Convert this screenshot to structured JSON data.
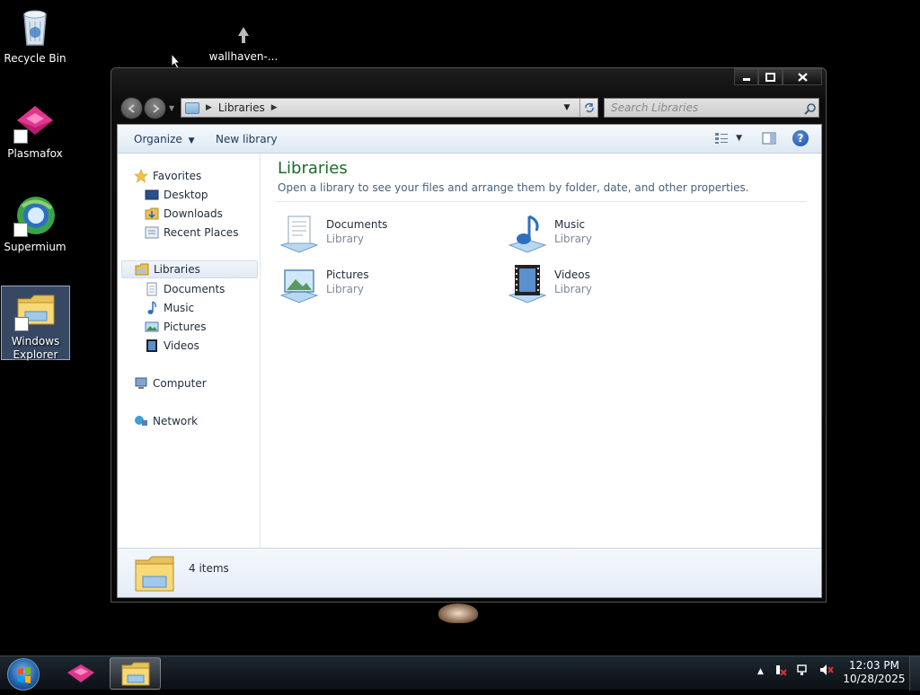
{
  "desktop": {
    "icons": [
      {
        "label": "Recycle Bin",
        "icon": "recycle-bin-icon"
      },
      {
        "label": "wallhaven-...",
        "icon": "image-file-icon"
      },
      {
        "label": "Plasmafox",
        "icon": "plasmafox-icon"
      },
      {
        "label": "Supermium",
        "icon": "supermium-icon"
      },
      {
        "label": "Windows Explorer",
        "icon": "windows-explorer-icon"
      }
    ]
  },
  "window": {
    "caption_buttons": {
      "minimize": "minimize",
      "maximize": "maximize",
      "close": "close"
    },
    "address": {
      "path": [
        "Libraries"
      ]
    },
    "search": {
      "placeholder": "Search Libraries"
    },
    "toolbar": {
      "organize": "Organize",
      "new_library": "New library",
      "help": "?"
    },
    "nav": {
      "favorites": "Favorites",
      "favorites_items": [
        "Desktop",
        "Downloads",
        "Recent Places"
      ],
      "libraries": "Libraries",
      "libraries_items": [
        "Documents",
        "Music",
        "Pictures",
        "Videos"
      ],
      "computer": "Computer",
      "network": "Network"
    },
    "content": {
      "title": "Libraries",
      "subtitle": "Open a library to see your files and arrange them by folder, date, and other properties.",
      "libraries": [
        {
          "name": "Documents",
          "type": "Library",
          "icon": "documents-library-icon"
        },
        {
          "name": "Music",
          "type": "Library",
          "icon": "music-library-icon"
        },
        {
          "name": "Pictures",
          "type": "Library",
          "icon": "pictures-library-icon"
        },
        {
          "name": "Videos",
          "type": "Library",
          "icon": "videos-library-icon"
        }
      ]
    },
    "details": {
      "count": "4 items"
    }
  },
  "taskbar": {
    "apps": [
      "Plasmafox",
      "Windows Explorer"
    ],
    "clock": {
      "time": "12:03 PM",
      "date": "10/28/2025"
    }
  }
}
